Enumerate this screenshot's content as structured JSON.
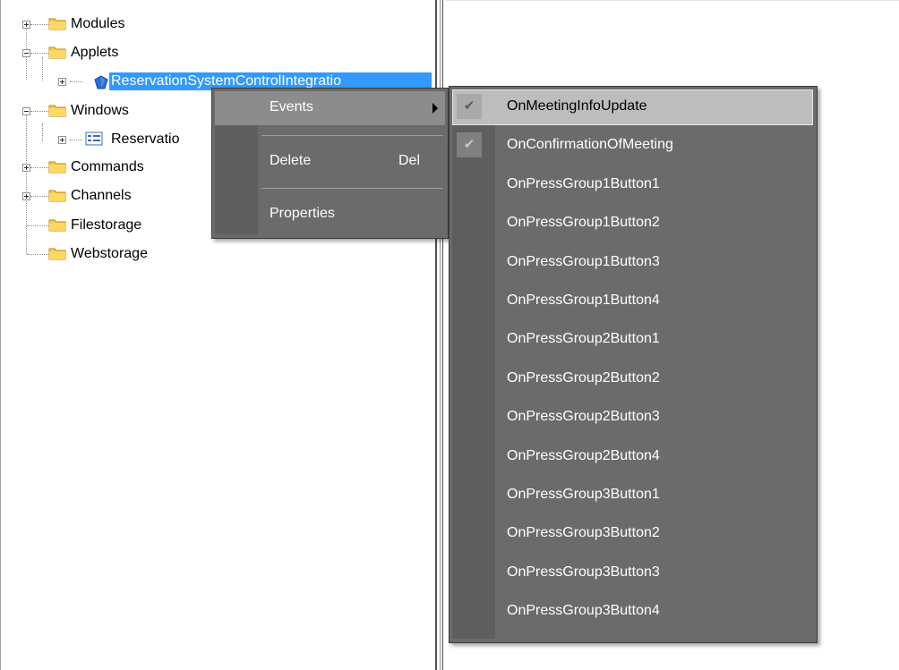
{
  "tree": {
    "nodes": [
      {
        "label": "Modules",
        "icon": "folder-icon",
        "expander": "plus"
      },
      {
        "label": "Applets",
        "icon": "folder-icon",
        "expander": "minus"
      },
      {
        "label": "ReservationSystemControlIntegratio",
        "icon": "applet-icon",
        "expander": "plus",
        "selected": true
      },
      {
        "label": "Windows",
        "icon": "folder-icon",
        "expander": "minus"
      },
      {
        "label": "Reservatio",
        "icon": "window-icon",
        "expander": "plus"
      },
      {
        "label": "Commands",
        "icon": "folder-icon",
        "expander": "plus"
      },
      {
        "label": "Channels",
        "icon": "folder-icon",
        "expander": "plus"
      },
      {
        "label": "Filestorage",
        "icon": "folder-icon",
        "expander": "none"
      },
      {
        "label": "Webstorage",
        "icon": "folder-icon",
        "expander": "none"
      }
    ]
  },
  "context_menu": {
    "items": [
      {
        "label": "Events",
        "shortcut": "",
        "submenu": true,
        "highlighted": true
      },
      {
        "label": "Delete",
        "shortcut": "Del",
        "submenu": false,
        "highlighted": false
      },
      {
        "label": "Properties",
        "shortcut": "",
        "submenu": false,
        "highlighted": false
      }
    ]
  },
  "events_submenu": {
    "items": [
      {
        "label": "OnMeetingInfoUpdate",
        "checked": true,
        "highlighted": true
      },
      {
        "label": "OnConfirmationOfMeeting",
        "checked": true,
        "highlighted": false
      },
      {
        "label": "OnPressGroup1Button1",
        "checked": false
      },
      {
        "label": "OnPressGroup1Button2",
        "checked": false
      },
      {
        "label": "OnPressGroup1Button3",
        "checked": false
      },
      {
        "label": "OnPressGroup1Button4",
        "checked": false
      },
      {
        "label": "OnPressGroup2Button1",
        "checked": false
      },
      {
        "label": "OnPressGroup2Button2",
        "checked": false
      },
      {
        "label": "OnPressGroup2Button3",
        "checked": false
      },
      {
        "label": "OnPressGroup2Button4",
        "checked": false
      },
      {
        "label": "OnPressGroup3Button1",
        "checked": false
      },
      {
        "label": "OnPressGroup3Button2",
        "checked": false
      },
      {
        "label": "OnPressGroup3Button3",
        "checked": false
      },
      {
        "label": "OnPressGroup3Button4",
        "checked": false
      }
    ],
    "check_glyph": "✔"
  },
  "colors": {
    "menu_bg": "#6b6b6b",
    "menu_highlight": "#8c8c8c",
    "submenu_highlight": "#bdbdbd",
    "selection": "#3399ff"
  }
}
